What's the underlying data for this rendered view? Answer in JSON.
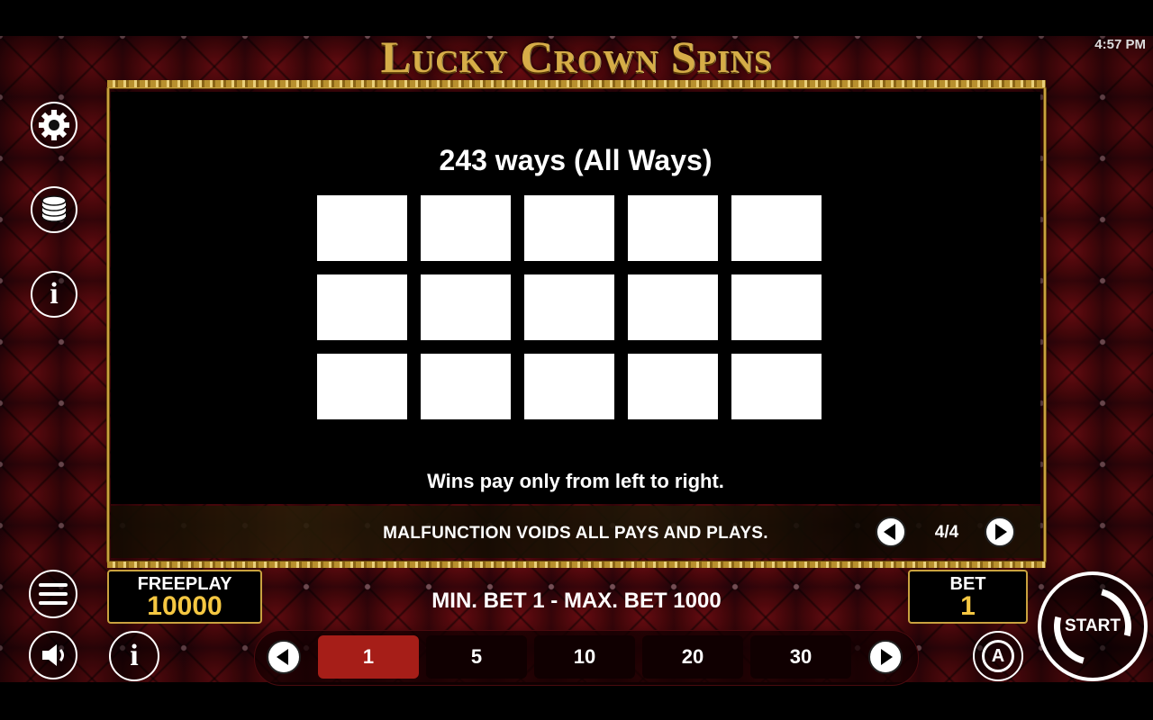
{
  "status_bar": {
    "time": "4:57 PM"
  },
  "game": {
    "title": "Lucky Crown Spins"
  },
  "paytable": {
    "title": "243 ways (All Ways)",
    "note": "Wins pay only from left to right.",
    "grid": {
      "rows": 3,
      "columns": 5
    }
  },
  "disclaimer": "MALFUNCTION VOIDS ALL PAYS AND PLAYS.",
  "pagination": {
    "page": "4/4"
  },
  "side_menu": {
    "icons": [
      "gear-icon",
      "coins-stack-icon",
      "info-icon",
      "menu-icon",
      "speaker-icon"
    ]
  },
  "freeplay": {
    "label": "FREEPLAY",
    "value": "10000"
  },
  "limits": "MIN. BET 1 - MAX. BET 1000",
  "bet": {
    "label": "BET",
    "value": "1"
  },
  "bet_options": [
    "1",
    "5",
    "10",
    "20",
    "30"
  ],
  "selected_bet_index": 0,
  "start_button": {
    "label": "START"
  },
  "autoplay_button": {
    "label": "A"
  },
  "colors": {
    "gold": "#c9a23f",
    "accent_red": "#a61e18",
    "value_yellow": "#f5c742"
  }
}
